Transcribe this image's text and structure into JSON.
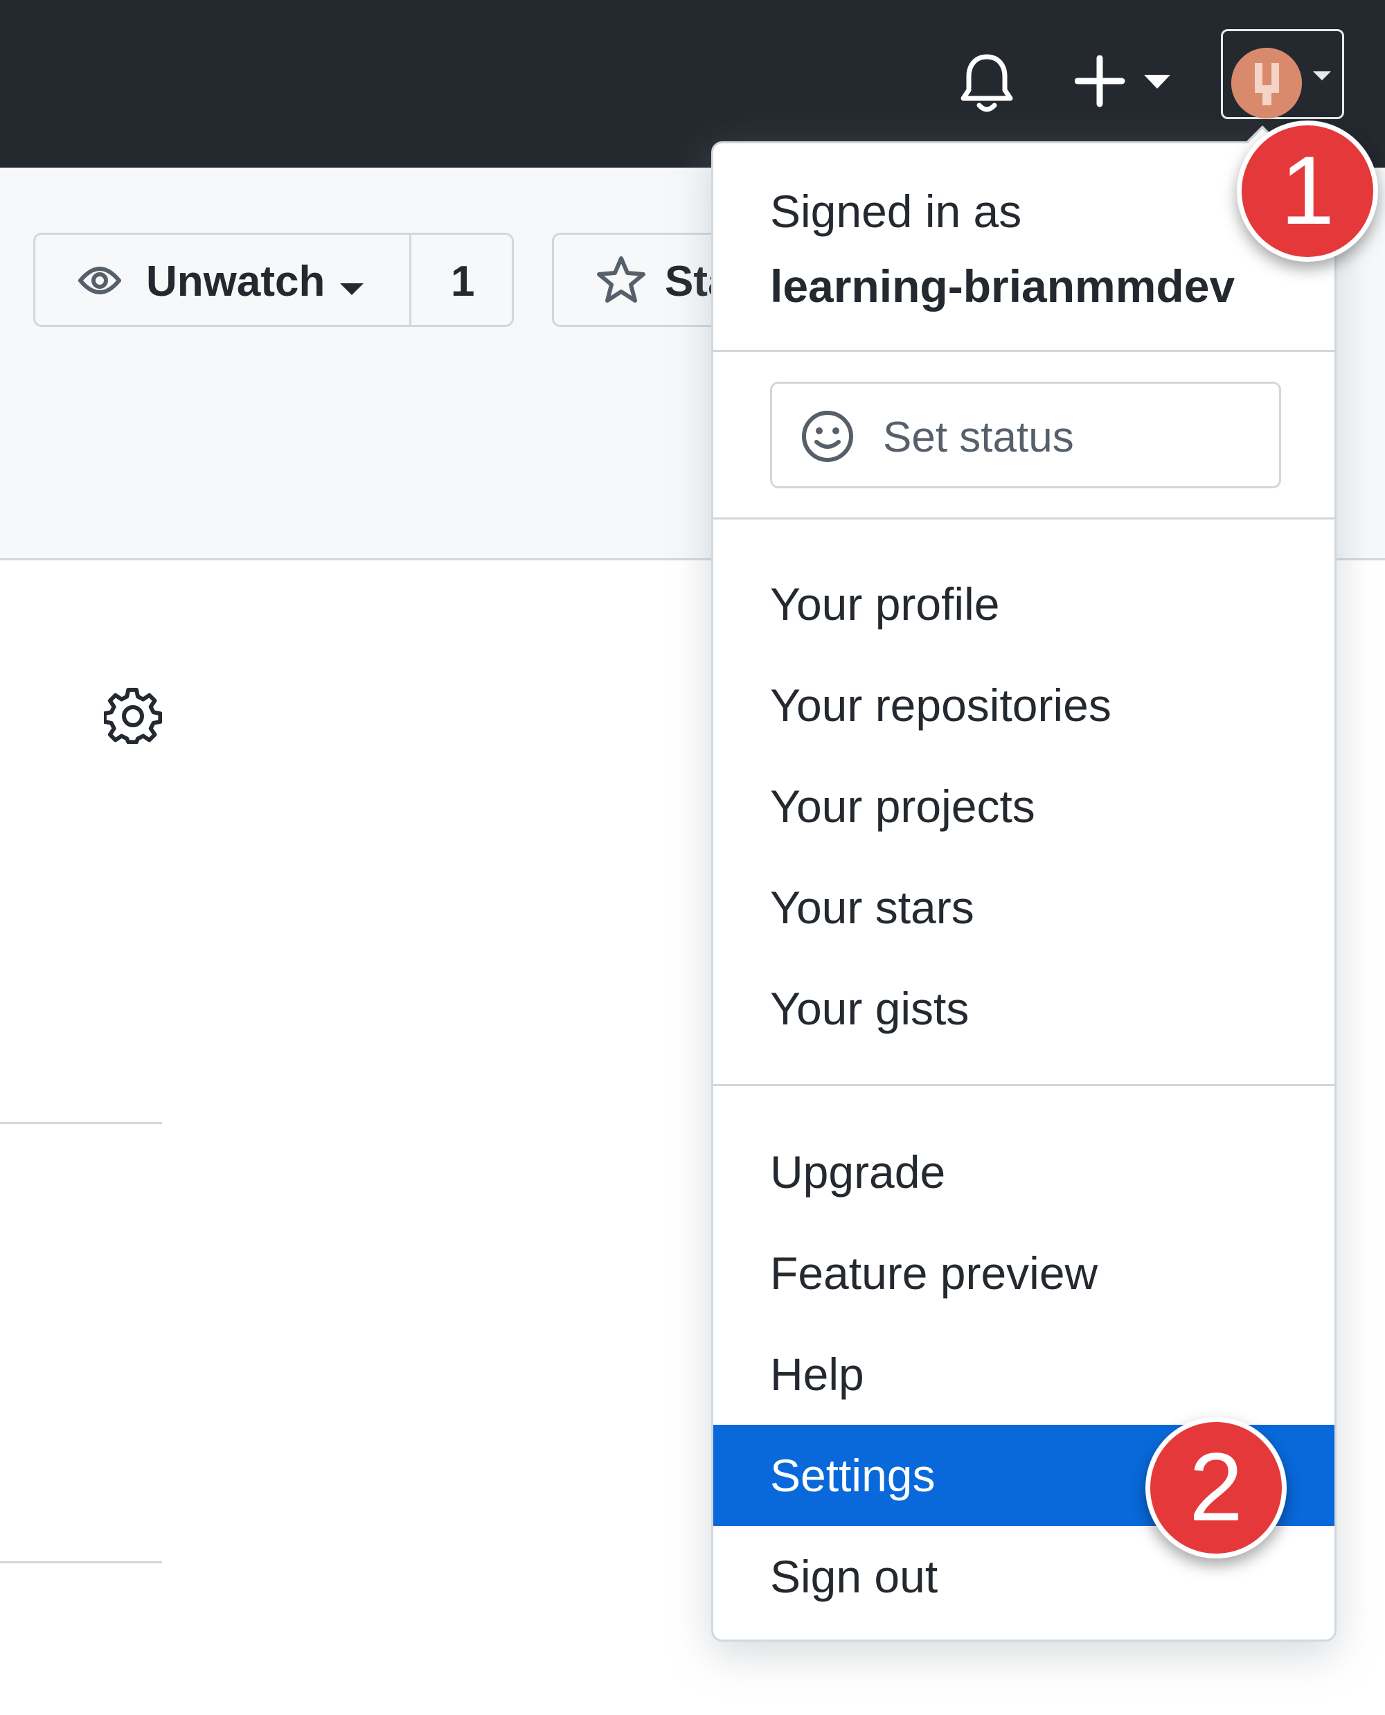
{
  "header": {
    "bell_icon": "bell-icon",
    "plus_icon": "plus-icon",
    "avatar_icon": "avatar-image"
  },
  "repo_actions": {
    "watch_label": "Unwatch",
    "watch_count": "1",
    "star_label": "Star"
  },
  "menu": {
    "signed_in_label": "Signed in as",
    "username": "learning-brianmmdev",
    "set_status_label": "Set status",
    "group_1": [
      "Your profile",
      "Your repositories",
      "Your projects",
      "Your stars",
      "Your gists"
    ],
    "group_2": [
      "Upgrade",
      "Feature preview",
      "Help",
      "Settings",
      "Sign out"
    ],
    "active_item": "Settings"
  },
  "callouts": {
    "step_1": "1",
    "step_2": "2"
  },
  "colors": {
    "header_bg": "#24292f",
    "accent": "#0969da",
    "badge": "#e5383b"
  }
}
